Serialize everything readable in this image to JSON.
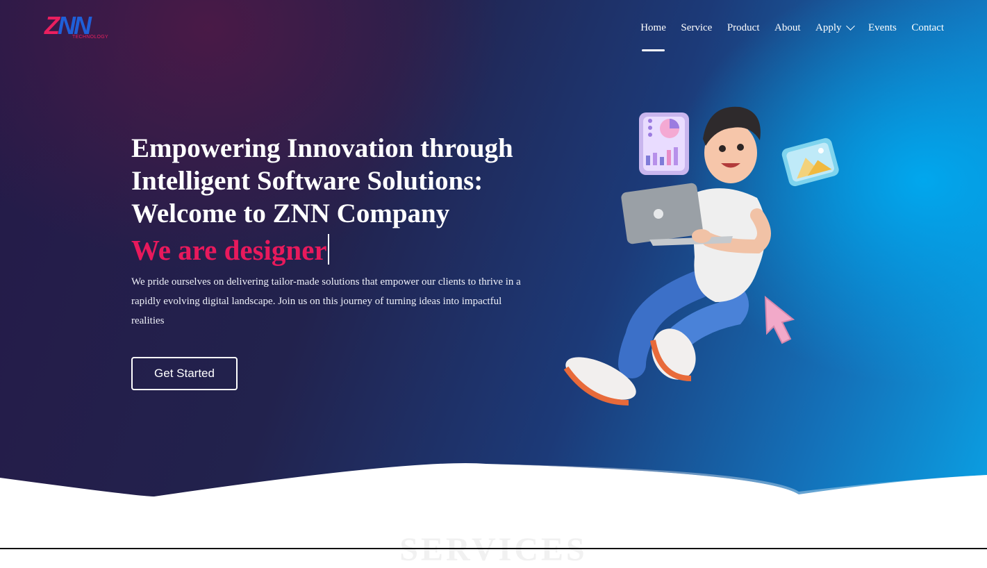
{
  "brand": {
    "logo_letters": [
      "Z",
      "NN"
    ],
    "tagline": "TECHNOLOGY",
    "colors": {
      "pink": "#ea1f5f",
      "blue": "#1f5fd8"
    }
  },
  "nav": {
    "items": [
      {
        "label": "Home",
        "active": true
      },
      {
        "label": "Service"
      },
      {
        "label": "Product"
      },
      {
        "label": "About"
      },
      {
        "label": "Apply",
        "has_dropdown": true
      },
      {
        "label": "Events"
      },
      {
        "label": "Contact"
      }
    ]
  },
  "hero": {
    "headline": "Empowering Innovation through Intelligent Software Solutions: Welcome to ZNN Company",
    "typed_text": "We are designer",
    "description": "We pride ourselves on delivering tailor-made solutions that empower our clients to thrive in a rapidly evolving digital landscape. Join us on this journey of turning ideas into impactful realities",
    "cta_label": "Get Started",
    "accent_color": "#e8195c"
  },
  "next_section": {
    "title": "SERVICES"
  }
}
